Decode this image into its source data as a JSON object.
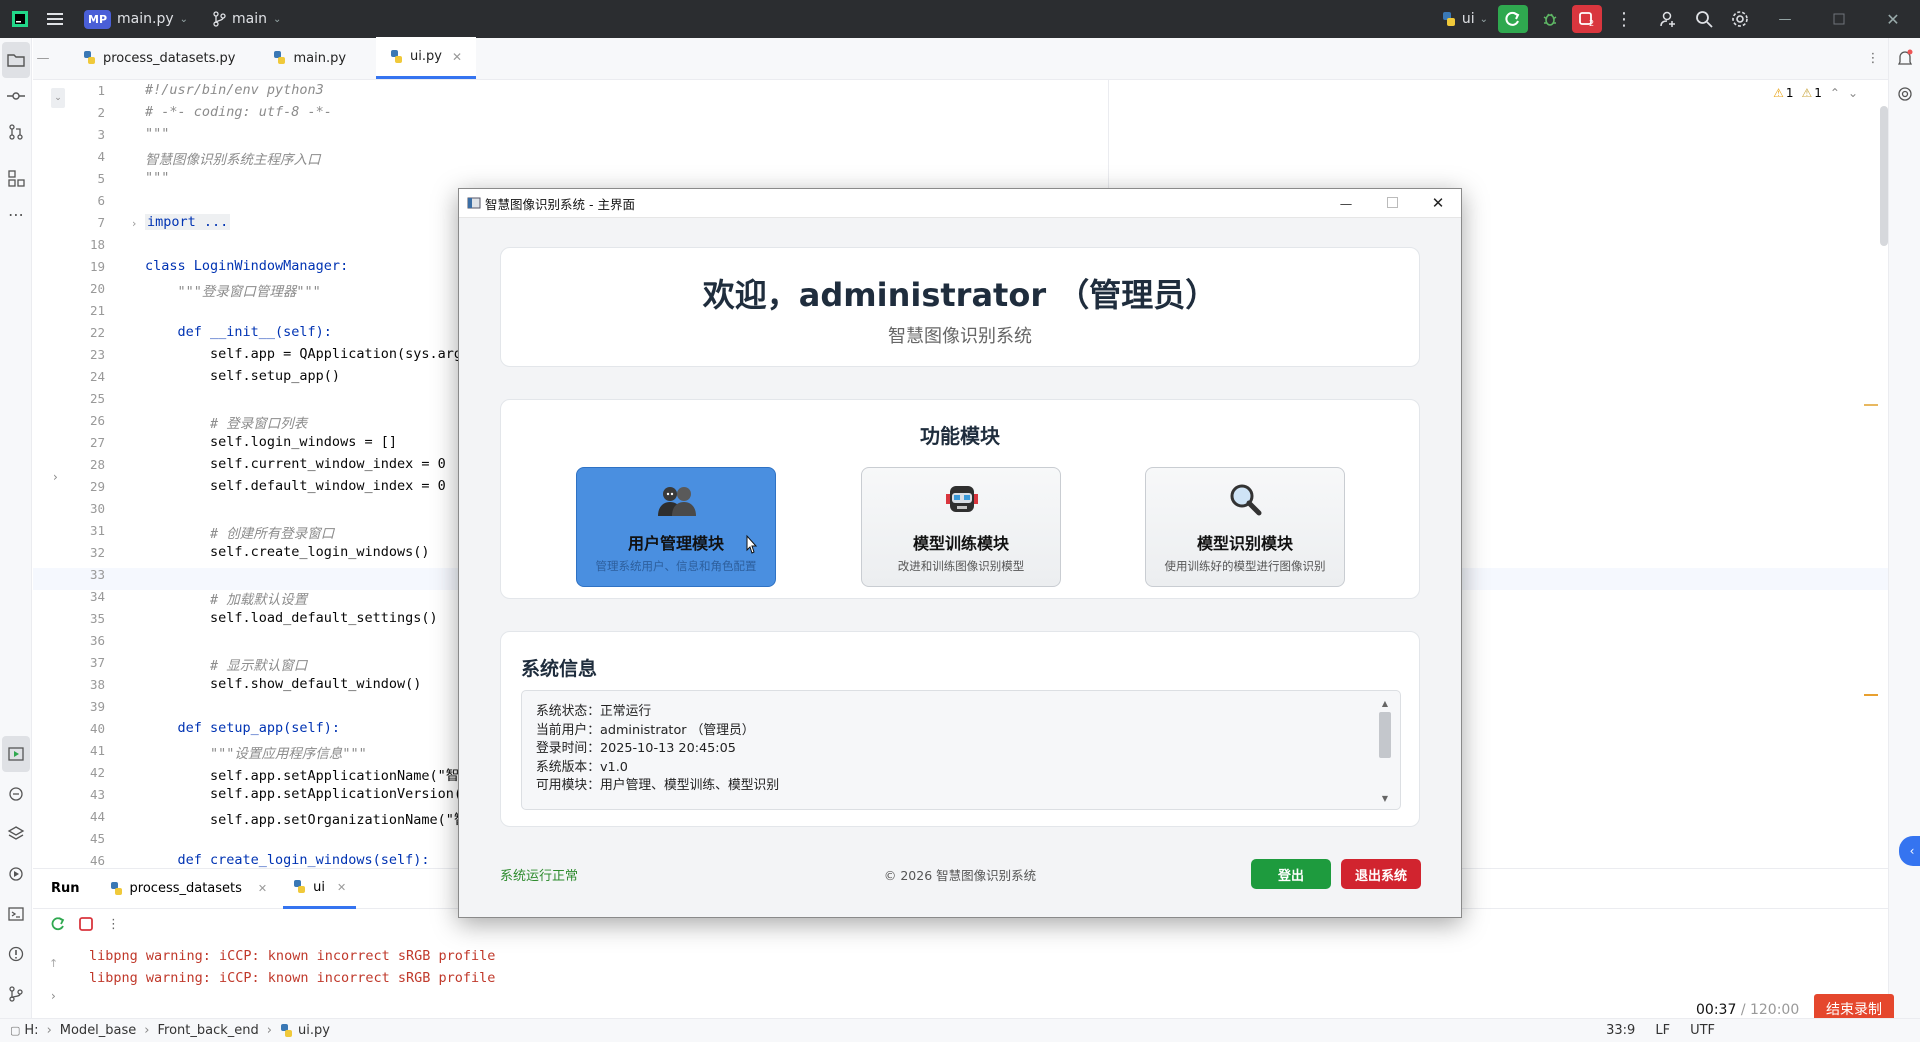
{
  "titlebar": {
    "project_badge": "MP",
    "project": "main.py",
    "branch": "main",
    "run_config": "ui"
  },
  "tabs": [
    {
      "label": "process_datasets.py"
    },
    {
      "label": "main.py"
    },
    {
      "label": "ui.py"
    }
  ],
  "editor": {
    "inspection": {
      "warnings": "1",
      "weak_warnings": "1"
    },
    "lines": [
      {
        "n": "1",
        "text": "#!/usr/bin/env python3"
      },
      {
        "n": "2",
        "text": "# -*- coding: utf-8 -*-"
      },
      {
        "n": "3",
        "text": "\"\"\""
      },
      {
        "n": "4",
        "text": "智慧图像识别系统主程序入口"
      },
      {
        "n": "5",
        "text": "\"\"\""
      },
      {
        "n": "6",
        "text": ""
      },
      {
        "n": "7",
        "text": "import ..."
      },
      {
        "n": "18",
        "text": ""
      },
      {
        "n": "19",
        "text": "class LoginWindowManager:"
      },
      {
        "n": "20",
        "text": "    \"\"\"登录窗口管理器\"\"\""
      },
      {
        "n": "21",
        "text": ""
      },
      {
        "n": "22",
        "text": "    def __init__(self):"
      },
      {
        "n": "23",
        "text": "        self.app = QApplication(sys.arg"
      },
      {
        "n": "24",
        "text": "        self.setup_app()"
      },
      {
        "n": "25",
        "text": ""
      },
      {
        "n": "26",
        "text": "        # 登录窗口列表"
      },
      {
        "n": "27",
        "text": "        self.login_windows = []"
      },
      {
        "n": "28",
        "text": "        self.current_window_index = 0"
      },
      {
        "n": "29",
        "text": "        self.default_window_index = 0"
      },
      {
        "n": "30",
        "text": ""
      },
      {
        "n": "31",
        "text": "        # 创建所有登录窗口"
      },
      {
        "n": "32",
        "text": "        self.create_login_windows()"
      },
      {
        "n": "33",
        "text": ""
      },
      {
        "n": "34",
        "text": "        # 加载默认设置"
      },
      {
        "n": "35",
        "text": "        self.load_default_settings()"
      },
      {
        "n": "36",
        "text": ""
      },
      {
        "n": "37",
        "text": "        # 显示默认窗口"
      },
      {
        "n": "38",
        "text": "        self.show_default_window()"
      },
      {
        "n": "39",
        "text": ""
      },
      {
        "n": "40",
        "text": "    def setup_app(self):"
      },
      {
        "n": "41",
        "text": "        \"\"\"设置应用程序信息\"\"\""
      },
      {
        "n": "42",
        "text": "        self.app.setApplicationName(\"智"
      },
      {
        "n": "43",
        "text": "        self.app.setApplicationVersion("
      },
      {
        "n": "44",
        "text": "        self.app.setOrganizationName(\"智"
      },
      {
        "n": "45",
        "text": ""
      },
      {
        "n": "46",
        "text": "    def create_login_windows(self):"
      }
    ]
  },
  "run_panel": {
    "title": "Run",
    "tabs": [
      {
        "label": "process_datasets"
      },
      {
        "label": "ui"
      }
    ],
    "output": [
      "libpng warning: iCCP: known incorrect sRGB profile",
      "libpng warning: iCCP: known incorrect sRGB profile"
    ]
  },
  "statusbar": {
    "crumbs": [
      "H:",
      "Model_base",
      "Front_back_end",
      "ui.py"
    ],
    "position": "33:9",
    "line_sep": "LF",
    "encoding": "UTF"
  },
  "recording": {
    "elapsed": "00:37",
    "total": "/ 120:00",
    "stop_label": "结束录制"
  },
  "dialog": {
    "title": "智慧图像识别系统 - 主界面",
    "welcome": "欢迎，administrator （管理员）",
    "subtitle": "智慧图像识别系统",
    "modules_title": "功能模块",
    "modules": [
      {
        "title": "用户管理模块",
        "desc": "管理系统用户、信息和角色配置"
      },
      {
        "title": "模型训练模块",
        "desc": "改进和训练图像识别模型"
      },
      {
        "title": "模型识别模块",
        "desc": "使用训练好的模型进行图像识别"
      }
    ],
    "sysinfo_title": "系统信息",
    "sysinfo_lines": [
      "系统状态：正常运行",
      "当前用户：administrator （管理员）",
      "登录时间：2025-10-13 20:45:05",
      "系统版本：v1.0",
      "可用模块：用户管理、模型训练、模型识别"
    ],
    "footer_status": "系统运行正常",
    "copyright": "© 2026 智慧图像识别系统",
    "logout_label": "登出",
    "exit_label": "退出系统"
  },
  "colors": {
    "accent": "#3574f0",
    "selected_module": "#4a8fe0",
    "logout_green": "#1e9b3e",
    "exit_red": "#d1242f",
    "status_green": "#2e8b2e",
    "record_red": "#e5472d"
  }
}
